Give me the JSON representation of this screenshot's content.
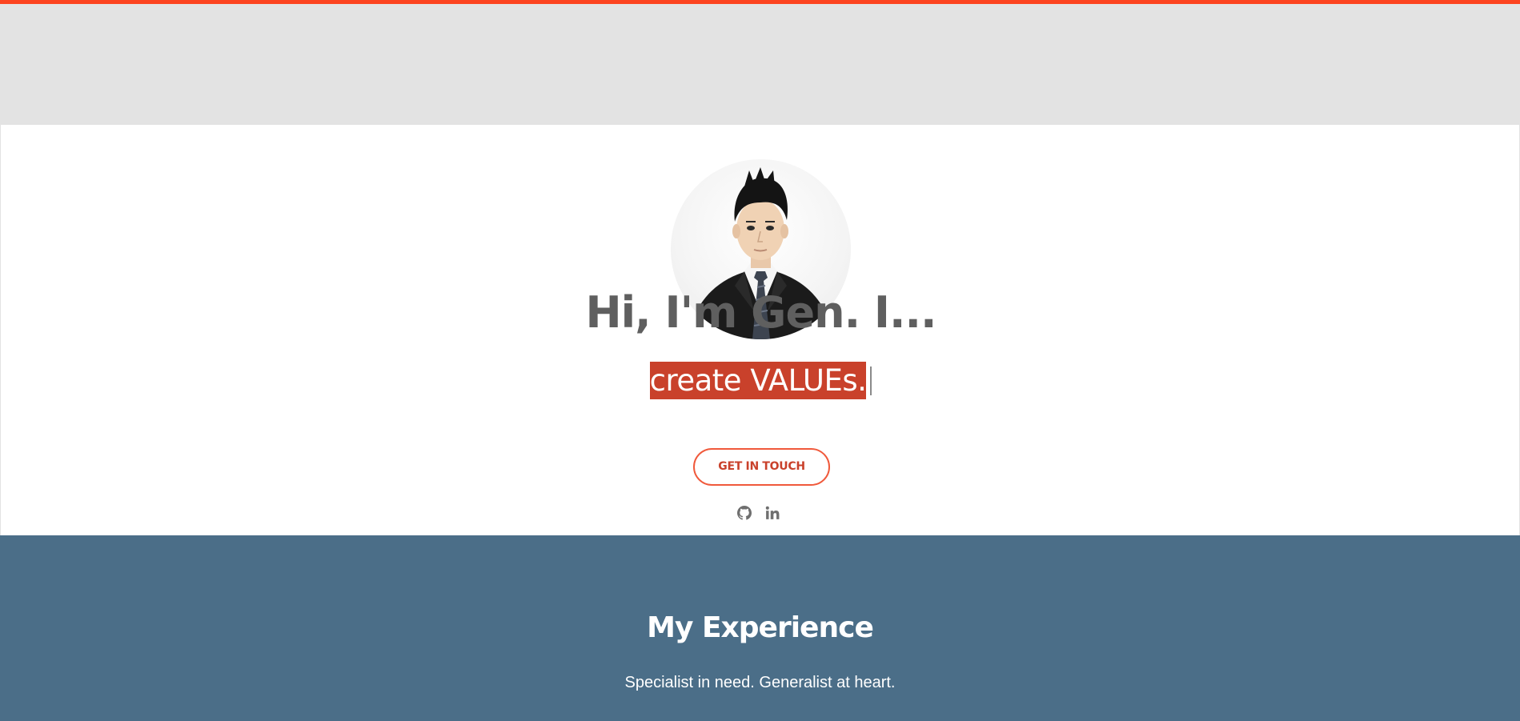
{
  "colors": {
    "accent": "#fd4420",
    "header_band": "#e3e3e3",
    "title_text": "#5f5f5f",
    "highlight": "#c9412b",
    "experience_bg": "#4b6e88"
  },
  "hero": {
    "avatar_alt": "profile-photo",
    "title": "Hi, I'm Gen. I...",
    "typed_text": "create VALUEs.",
    "cta_label": "GET IN TOUCH",
    "social": [
      {
        "name": "github",
        "icon": "github-icon"
      },
      {
        "name": "linkedin",
        "icon": "linkedin-icon"
      }
    ]
  },
  "experience": {
    "title": "My Experience",
    "subtitle": "Specialist in need. Generalist at heart."
  }
}
